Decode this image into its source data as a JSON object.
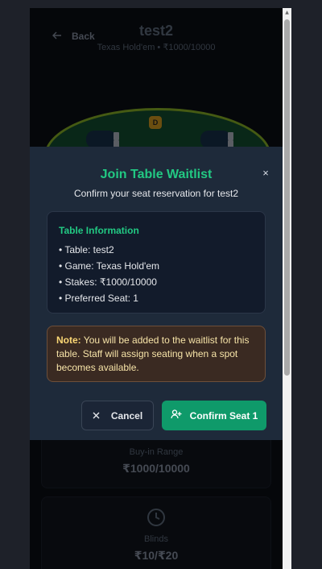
{
  "header": {
    "back_label": "Back",
    "title": "test2",
    "subtitle": "Texas Hold'em • ₹1000/10000"
  },
  "table_view": {
    "dealer_badge": "D"
  },
  "info_cards": [
    {
      "label": "Buy-in Range",
      "value": "₹1000/10000"
    },
    {
      "label": "Blinds",
      "value": "₹10/₹20"
    }
  ],
  "modal": {
    "title": "Join Table Waitlist",
    "subtitle": "Confirm your seat reservation for test2",
    "close_icon": "×",
    "table_info": {
      "heading": "Table Information",
      "items": [
        "• Table: test2",
        "• Game: Texas Hold'em",
        "• Stakes: ₹1000/10000",
        "• Preferred Seat: 1"
      ]
    },
    "note": {
      "prefix": "Note:",
      "text": " You will be added to the waitlist for this table. Staff will assign seating when a spot becomes available."
    },
    "cancel_label": "Cancel",
    "confirm_label": "Confirm Seat 1"
  },
  "colors": {
    "accent": "#22c983",
    "confirm_button": "#0f9a6a",
    "modal_bg": "#1e2a3a",
    "note_bg": "#3a2a22"
  }
}
